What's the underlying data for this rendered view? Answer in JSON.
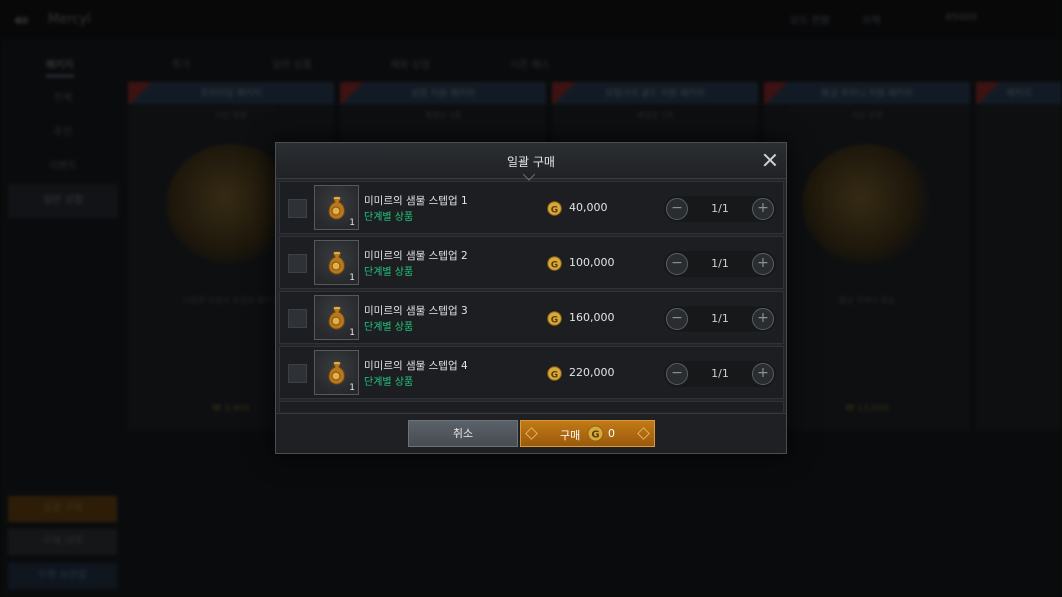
{
  "background": {
    "window_title": "Mercyl",
    "top_right": [
      "모드 전환",
      "지역",
      "45000"
    ],
    "tabs": [
      "패키지",
      "특가",
      "일반 상품",
      "재화 상점",
      "시즌 패스"
    ],
    "sidebar_items": [
      "전체",
      "추천",
      "이벤트",
      "일반 상점"
    ],
    "sidebar_buttons": [
      "일괄 구매",
      "구매 내역",
      "우편 보관함"
    ],
    "cards": [
      {
        "title": "프리미엄 패키지",
        "sub": "기간 한정",
        "desc": "다양한 보상이 포함된 패키지",
        "price": "₩ 3,900"
      },
      {
        "title": "성장 지원 패키지",
        "sub": "계정당 1회",
        "desc": "",
        "price": ""
      },
      {
        "title": "모험가의 골드 지원 패키지",
        "sub": "계정당 1회",
        "desc": "",
        "price": ""
      },
      {
        "title": "황금 주머니 지원 패키지",
        "sub": "기간 한정",
        "desc": "황금 주머니 묶음",
        "price": "₩ 13,000"
      },
      {
        "title": "패키지",
        "sub": "",
        "desc": "",
        "price": ""
      }
    ]
  },
  "dialog": {
    "title": "일괄 구매",
    "items": [
      {
        "name": "미미르의 샘물 스텝업 1",
        "tag": "단계별 상품",
        "qty": "1",
        "price": "40,000",
        "count": "1/1"
      },
      {
        "name": "미미르의 샘물 스텝업 2",
        "tag": "단계별 상품",
        "qty": "1",
        "price": "100,000",
        "count": "1/1"
      },
      {
        "name": "미미르의 샘물 스텝업 3",
        "tag": "단계별 상품",
        "qty": "1",
        "price": "160,000",
        "count": "1/1"
      },
      {
        "name": "미미르의 샘물 스텝업 4",
        "tag": "단계별 상품",
        "qty": "1",
        "price": "220,000",
        "count": "1/1"
      }
    ],
    "cancel_label": "취소",
    "buy_label": "구매",
    "buy_total": "0",
    "coin_icon": "gold-coin-icon",
    "colors": {
      "accent": "#c27a17",
      "tag": "#22c57f"
    }
  }
}
